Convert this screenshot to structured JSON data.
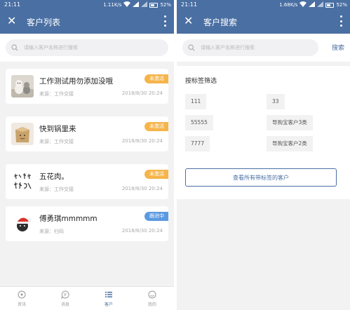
{
  "left": {
    "status": {
      "time": "21:11",
      "speed": "1.11K/s",
      "battery": "52%"
    },
    "appbar": {
      "close_label": "✕",
      "title": "客户列表"
    },
    "search": {
      "placeholder": "请输入客户名称进行搜索"
    },
    "customers": [
      {
        "name": "工作测试用勿添加没哦",
        "source": "来源：工作交接",
        "date": "2018/8/30 20:24",
        "badge": "未激活",
        "badge_color": "#f5b54a"
      },
      {
        "name": "快到锅里来",
        "source": "来源：工作交接",
        "date": "2018/8/30 20:24",
        "badge": "未激活",
        "badge_color": "#f5b54a"
      },
      {
        "name": "五花肉。",
        "source": "来源：工作交接",
        "date": "2018/8/30 20:24",
        "badge": "未激活",
        "badge_color": "#f5b54a"
      },
      {
        "name": "傅勇琪mmmmm",
        "source": "来源：扫码",
        "date": "2018/8/30 20:24",
        "badge": "跟进中",
        "badge_color": "#5b9ae0"
      }
    ],
    "tabs": [
      {
        "label": "资讯",
        "icon": "compass-icon"
      },
      {
        "label": "消息",
        "icon": "chat-icon"
      },
      {
        "label": "客户",
        "icon": "list-icon"
      },
      {
        "label": "我的",
        "icon": "profile-icon"
      }
    ]
  },
  "right": {
    "status": {
      "time": "21:11",
      "speed": "1.68K/s",
      "battery": "52%"
    },
    "appbar": {
      "close_label": "✕",
      "title": "客户搜索"
    },
    "search": {
      "placeholder": "请输入客户名称进行搜索",
      "button": "搜索"
    },
    "filter": {
      "title": "按标签筛选",
      "tags": [
        "111",
        "33",
        "55555",
        "导购宝客户3类",
        "7777",
        "导购宝客户2类"
      ],
      "view_all": "查看所有带标签的客户"
    }
  },
  "colors": {
    "primary": "#4a6fa3",
    "badge_inactive": "#f5b54a",
    "badge_following": "#5b9ae0",
    "background": "#f2f2f2"
  }
}
